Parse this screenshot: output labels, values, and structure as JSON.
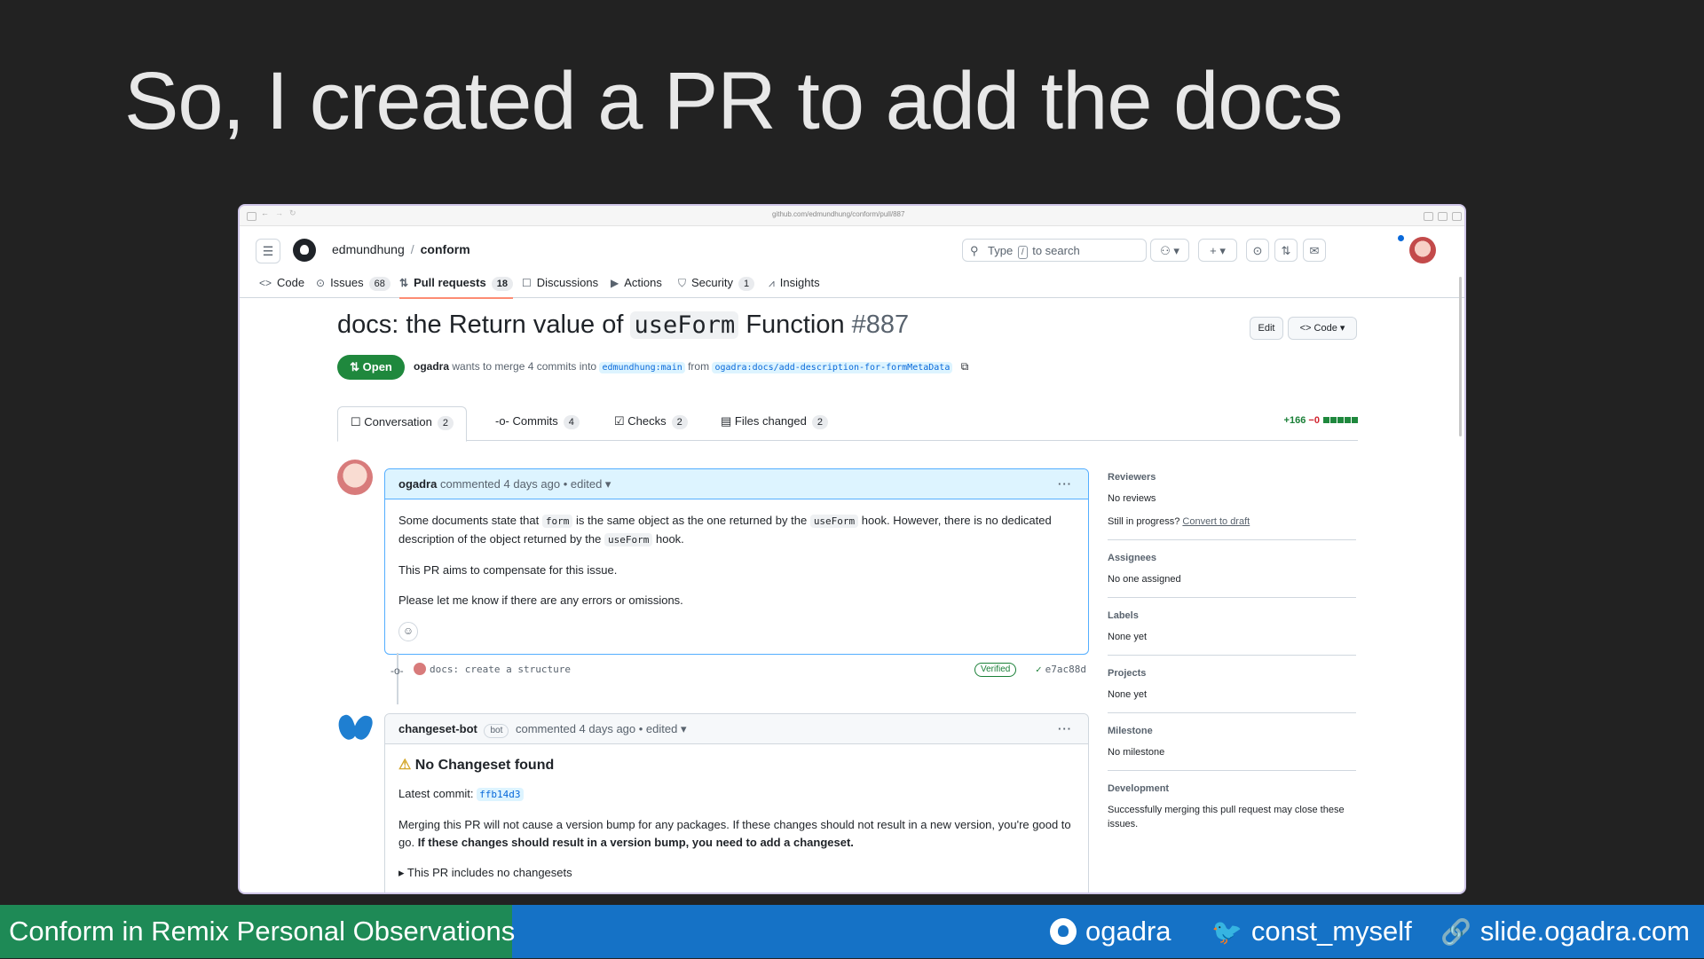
{
  "slide": {
    "title": "So, I created a PR to add the docs"
  },
  "browser": {
    "url": "github.com/edmundhung/conform/pull/887"
  },
  "header": {
    "owner": "edmundhung",
    "separator": "/",
    "repo": "conform",
    "search_prefix": "Type",
    "search_key": "/",
    "search_suffix": "to search"
  },
  "repo_nav": [
    {
      "icon": "<>",
      "label": "Code",
      "count": ""
    },
    {
      "icon": "⊙",
      "label": "Issues",
      "count": "68"
    },
    {
      "icon": "⇅",
      "label": "Pull requests",
      "count": "18"
    },
    {
      "icon": "☐",
      "label": "Discussions",
      "count": ""
    },
    {
      "icon": "▶",
      "label": "Actions",
      "count": ""
    },
    {
      "icon": "⛉",
      "label": "Security",
      "count": "1"
    },
    {
      "icon": "⩘",
      "label": "Insights",
      "count": ""
    }
  ],
  "pr": {
    "title_prefix": "docs: the Return value of",
    "title_code": "useForm",
    "title_suffix": "Function",
    "number": "#887",
    "edit_label": "Edit",
    "code_label": "Code",
    "state": "Open",
    "author": "ogadra",
    "merge_text": "wants to merge 4 commits into",
    "base_branch": "edmundhung:main",
    "from_text": "from",
    "head_branch": "ogadra:docs/add-description-for-formMetaData"
  },
  "tabs": [
    {
      "label": "Conversation",
      "count": "2"
    },
    {
      "label": "Commits",
      "count": "4"
    },
    {
      "label": "Checks",
      "count": "2"
    },
    {
      "label": "Files changed",
      "count": "2"
    }
  ],
  "diffstat": {
    "additions": "+166",
    "deletions": "−0"
  },
  "comment1": {
    "author": "ogadra",
    "meta": "commented 4 days ago • edited",
    "p1_a": "Some documents state that",
    "p1_code1": "form",
    "p1_b": "is the same object as the one returned by the",
    "p1_code2": "useForm",
    "p1_c": "hook. However, there is no dedicated description of the object returned by the",
    "p1_code3": "useForm",
    "p1_d": "hook.",
    "p2": "This PR aims to compensate for this issue.",
    "p3": "Please let me know if there are any errors or omissions."
  },
  "commit": {
    "message": "docs: create a structure",
    "verified": "Verified",
    "sha": "e7ac88d"
  },
  "comment2": {
    "author": "changeset-bot",
    "badge": "bot",
    "meta": "commented 4 days ago • edited",
    "heading": "No Changeset found",
    "latest_label": "Latest commit:",
    "latest_sha": "ffb14d3",
    "p1": "Merging this PR will not cause a version bump for any packages. If these changes should not result in a new version, you're good to go.",
    "p1_bold": "If these changes should result in a version bump, you need to add a changeset.",
    "details": "This PR includes no changesets"
  },
  "sidebar": {
    "reviewers_h": "Reviewers",
    "reviewers_t": "No reviews",
    "progress_t": "Still in progress?",
    "progress_link": "Convert to draft",
    "assignees_h": "Assignees",
    "assignees_t": "No one assigned",
    "labels_h": "Labels",
    "labels_t": "None yet",
    "projects_h": "Projects",
    "projects_t": "None yet",
    "milestone_h": "Milestone",
    "milestone_t": "No milestone",
    "development_h": "Development",
    "development_t": "Successfully merging this pull request may close these issues."
  },
  "footer": {
    "talk": "Conform in Remix Personal Observations",
    "github": "ogadra",
    "twitter": "const_myself",
    "site": "slide.ogadra.com"
  },
  "colors": {
    "open_green": "#1f883d",
    "link_blue": "#0969da",
    "footer_green": "#1e8a56",
    "footer_blue": "#1572c6"
  }
}
